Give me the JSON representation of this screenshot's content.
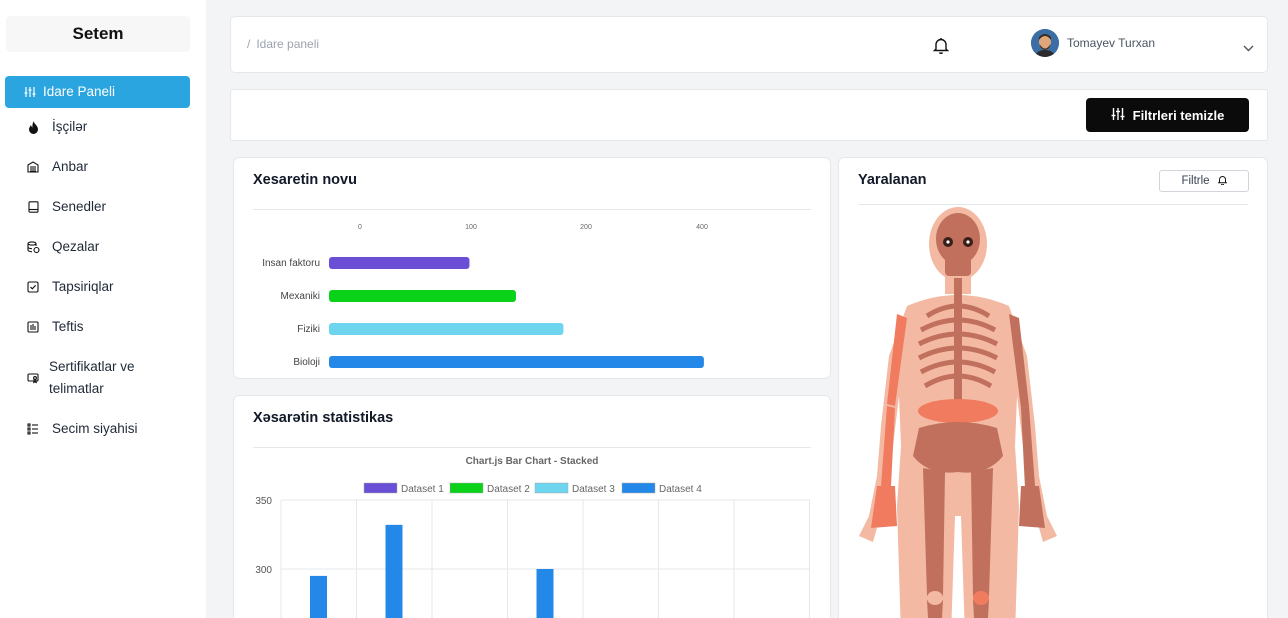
{
  "sidebar": {
    "logo": "Setem",
    "items": [
      {
        "label": "Idare Paneli",
        "icon": "sliders-icon",
        "active": true
      },
      {
        "label": "İşçilər",
        "icon": "flame-icon"
      },
      {
        "label": "Anbar",
        "icon": "warehouse-icon"
      },
      {
        "label": "Senedler",
        "icon": "document-icon"
      },
      {
        "label": "Qezalar",
        "icon": "database-alert-icon"
      },
      {
        "label": "Tapsiriqlar",
        "icon": "checkbox-icon"
      },
      {
        "label": "Teftis",
        "icon": "inspection-icon"
      },
      {
        "label": "Sertifikatlar ve telimatlar",
        "icon": "certificate-icon"
      },
      {
        "label": "Secim siyahisi",
        "icon": "list-icon"
      }
    ]
  },
  "header": {
    "breadcrumb_sep": "/",
    "breadcrumb": "Idare paneli",
    "user_name": "Tomayev Turxan"
  },
  "filters": {
    "clear_label": "Filtrleri temizle"
  },
  "card_injury_type": {
    "title": "Xesaretin novu"
  },
  "card_stats": {
    "title": "Xəsarətin statistikas"
  },
  "card_injured": {
    "title": "Yaralanan",
    "filter_label": "Filtrle"
  },
  "colors": {
    "accent": "#2aa5e0",
    "purple": "#6a4fd6",
    "green": "#0ad21a",
    "cyan": "#6dd5ee",
    "blue": "#2488e8"
  },
  "chart_data": [
    {
      "type": "bar",
      "orientation": "horizontal",
      "title": "",
      "x_ticks": [
        "0",
        "100",
        "200",
        "400"
      ],
      "categories": [
        "Insan faktoru",
        "Mexaniki",
        "Fiziki",
        "Bioloji"
      ],
      "values": [
        145,
        193,
        242,
        387
      ],
      "colors": [
        "#6a4fd6",
        "#0ad21a",
        "#6dd5ee",
        "#2488e8"
      ],
      "xlim": [
        0,
        480
      ]
    },
    {
      "type": "bar",
      "stacked": true,
      "title": "Chart.js Bar Chart - Stacked",
      "legend": [
        "Dataset 1",
        "Dataset 2",
        "Dataset 3",
        "Dataset 4"
      ],
      "legend_colors": [
        "#6a4fd6",
        "#0ad21a",
        "#6dd5ee",
        "#2488e8"
      ],
      "y_ticks": [
        "350",
        "300"
      ],
      "ylim": [
        0,
        350
      ],
      "series": [
        {
          "name": "Dataset 4",
          "values": [
            295,
            332,
            null,
            300,
            null,
            null,
            null
          ]
        }
      ]
    }
  ]
}
